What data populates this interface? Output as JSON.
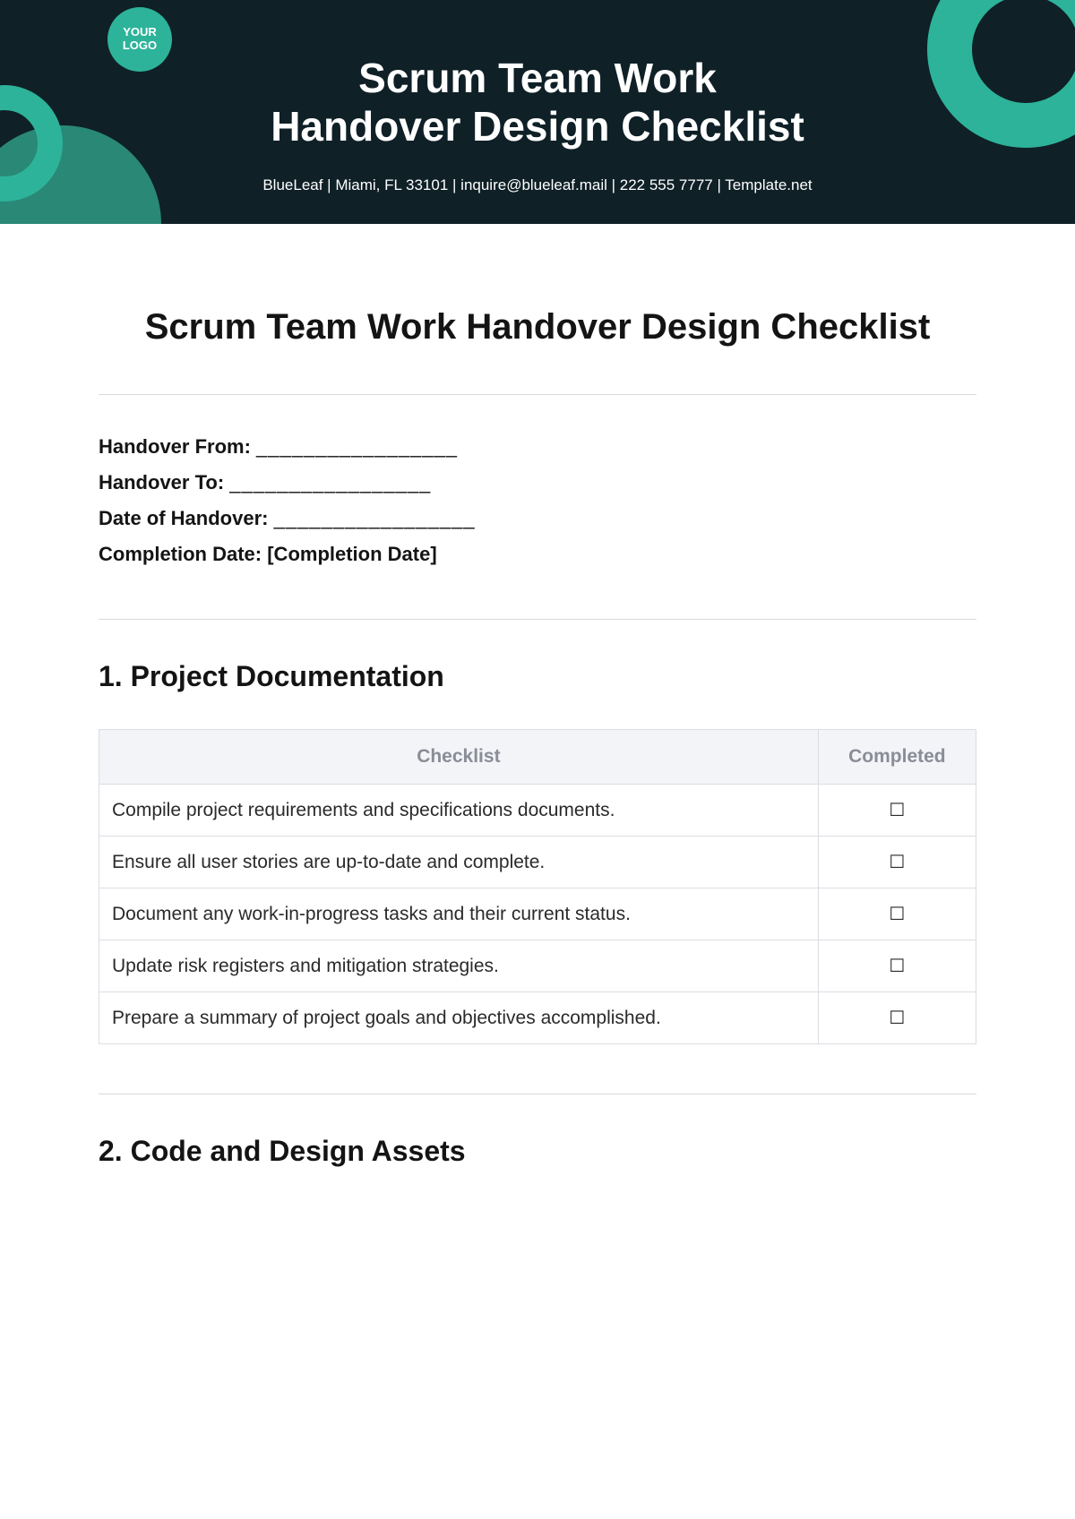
{
  "header": {
    "logo_text": "YOUR\nLOGO",
    "title_line1": "Scrum Team Work",
    "title_line2": "Handover Design Checklist",
    "contact": "BlueLeaf  |  Miami, FL 33101  |  inquire@blueleaf.mail | 222 555 7777 | Template.net"
  },
  "doc": {
    "title": "Scrum Team Work Handover Design Checklist",
    "fields": {
      "from_label": "Handover From: ",
      "from_blank": "_________________",
      "to_label": "Handover To: ",
      "to_blank": "_________________",
      "date_label": "Date of Handover: ",
      "date_blank": "_________________",
      "completion_label": "Completion Date: ",
      "completion_value": "[Completion Date]"
    }
  },
  "sections": [
    {
      "heading": "1. Project Documentation",
      "columns": {
        "checklist": "Checklist",
        "completed": "Completed"
      },
      "rows": [
        {
          "text": "Compile project requirements and specifications documents.",
          "box": "☐"
        },
        {
          "text": "Ensure all user stories are up-to-date and complete.",
          "box": "☐"
        },
        {
          "text": "Document any work-in-progress tasks and their current status.",
          "box": "☐"
        },
        {
          "text": "Update risk registers and mitigation strategies.",
          "box": "☐"
        },
        {
          "text": "Prepare a summary of project goals and objectives accomplished.",
          "box": "☐"
        }
      ]
    },
    {
      "heading": "2. Code and Design Assets"
    }
  ]
}
